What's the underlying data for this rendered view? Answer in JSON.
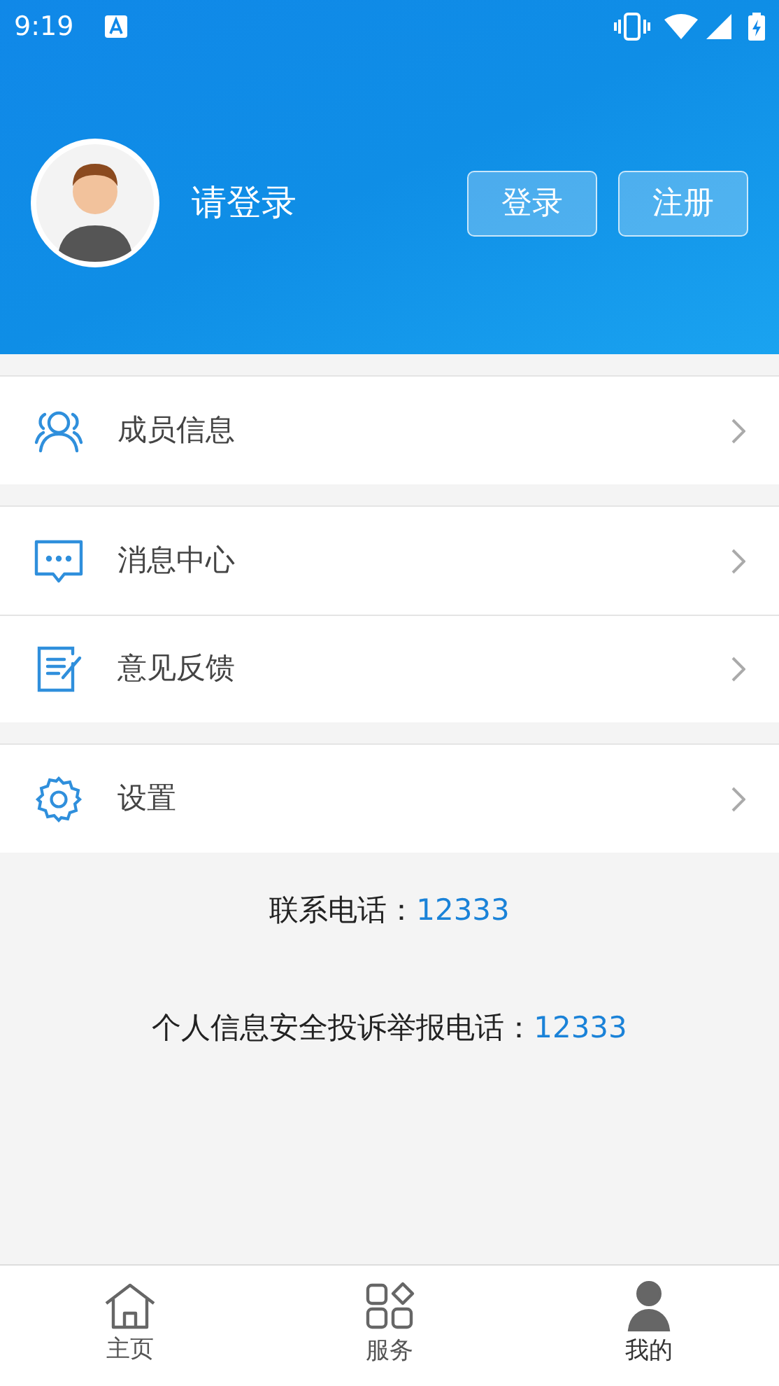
{
  "status_bar": {
    "time": "9:19"
  },
  "profile": {
    "prompt": "请登录",
    "buttons": [
      "登录",
      "注册"
    ]
  },
  "menu_groups": [
    [
      {
        "kind": "members",
        "label": "成员信息"
      }
    ],
    [
      {
        "kind": "messages",
        "label": "消息中心"
      },
      {
        "kind": "feedback",
        "label": "意见反馈"
      }
    ],
    [
      {
        "kind": "settings",
        "label": "设置"
      }
    ]
  ],
  "contacts": [
    {
      "label": "联系电话：",
      "number": "12333"
    },
    {
      "label": "个人信息安全投诉举报电话：",
      "number": "12333"
    }
  ],
  "bottom_nav": [
    {
      "kind": "home",
      "label": "主页",
      "selected": false
    },
    {
      "kind": "services",
      "label": "服务",
      "selected": false
    },
    {
      "kind": "mine",
      "label": "我的",
      "selected": true
    }
  ]
}
